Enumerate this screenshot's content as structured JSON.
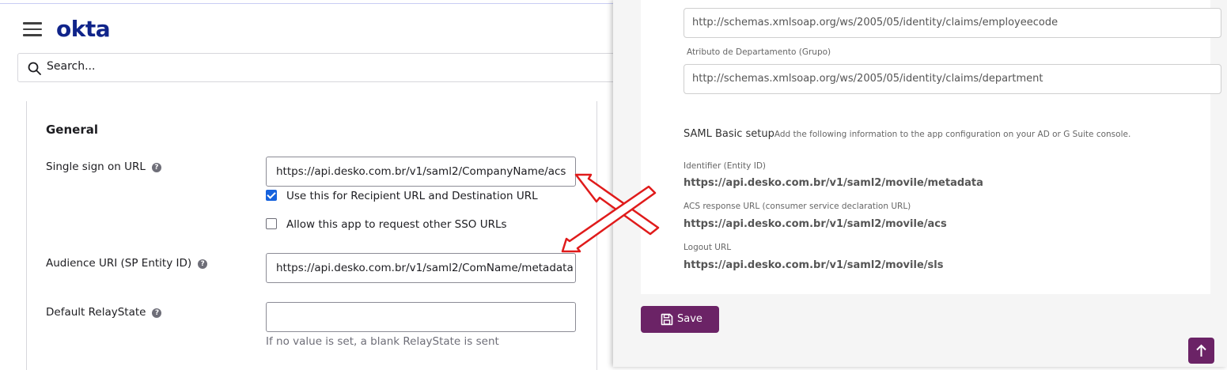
{
  "okta": {
    "logo": "okta",
    "search": {
      "placeholder": "Search..."
    },
    "general": {
      "title": "General",
      "sso_url": {
        "label": "Single sign on URL",
        "value": "https://api.desko.com.br/v1/saml2/CompanyName/acs"
      },
      "recipient_checkbox": {
        "label": "Use this for Recipient URL and Destination URL",
        "checked": true
      },
      "other_sso_checkbox": {
        "label": "Allow this app to request other SSO URLs",
        "checked": false
      },
      "audience_uri": {
        "label": "Audience URI (SP Entity ID)",
        "value": "https://api.desko.com.br/v1/saml2/ComName/metadata"
      },
      "relay_state": {
        "label": "Default RelayState",
        "value": "",
        "hint": "If no value is set, a blank RelayState is sent"
      },
      "help_glyph": "?"
    }
  },
  "desko": {
    "employee_claim": "http://schemas.xmlsoap.org/ws/2005/05/identity/claims/employeecode",
    "department_label": "Atributo de Departamento (Grupo)",
    "department_claim": "http://schemas.xmlsoap.org/ws/2005/05/identity/claims/department",
    "saml_title": "SAML Basic setup",
    "saml_subtitle": "Add the following information to the app configuration on your AD or G Suite console.",
    "identifier_label": "Identifier (Entity ID)",
    "identifier_value": "https://api.desko.com.br/v1/saml2/movile/metadata",
    "acs_label": "ACS response URL (consumer service declaration URL)",
    "acs_value": "https://api.desko.com.br/v1/saml2/movile/acs",
    "logout_label": "Logout URL",
    "logout_value": "https://api.desko.com.br/v1/saml2/movile/sls",
    "save_label": "Save"
  },
  "colors": {
    "okta_blue": "#10248a",
    "checkbox_blue": "#1662dd",
    "desko_purple": "#6b2366",
    "arrow_red": "#e01b1b"
  },
  "icons": [
    "hamburger-icon",
    "search-icon",
    "help-icon",
    "checkmark-icon",
    "save-icon",
    "arrow-up-icon"
  ]
}
